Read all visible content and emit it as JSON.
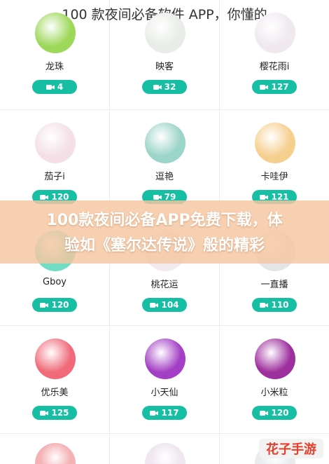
{
  "page": {
    "title": "100 款夜间必备软件 APP，你懂的",
    "banner_line1": "100款夜间必备APP免费下载，体",
    "banner_line2": "验如《塞尔达传说》般的精彩",
    "watermark": "花子手游"
  },
  "apps": [
    {
      "name": "龙珠",
      "count": "4",
      "color": "#9ed85a"
    },
    {
      "name": "映客",
      "count": "32",
      "color": "#e8ece6"
    },
    {
      "name": "樱花雨i",
      "count": "127",
      "color": "#efe8ef"
    },
    {
      "name": "茄子i",
      "count": "120",
      "color": "#f3dfe5"
    },
    {
      "name": "逗艳",
      "count": "79",
      "color": "#9bd4c8"
    },
    {
      "name": "卡哇伊",
      "count": "121",
      "color": "#f5cf8e"
    },
    {
      "name": "Gboy",
      "count": "120",
      "color": "#6fdcc3"
    },
    {
      "name": "桃花运",
      "count": "104",
      "color": "#f2e9ee"
    },
    {
      "name": "一直播",
      "count": "110",
      "color": "#e5e5e5"
    },
    {
      "name": "优乐美",
      "count": "125",
      "color": "#f06a7a"
    },
    {
      "name": "小天仙",
      "count": "117",
      "color": "#a33fc4"
    },
    {
      "name": "小米粒",
      "count": "120",
      "color": "#9e2f9e"
    }
  ],
  "row5": [
    "#f3b2b4",
    "#efe6f0",
    "#e9ecef"
  ],
  "colors": {
    "accent": "#16bfa4",
    "brand": "#e83e2b"
  }
}
